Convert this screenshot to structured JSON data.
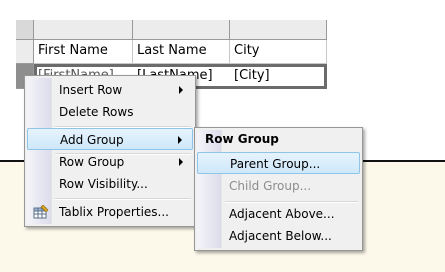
{
  "tablix": {
    "headers": [
      "First Name",
      "Last Name",
      "City"
    ],
    "placeholders": [
      "[FirstName]",
      "[LastName]",
      "[City]"
    ]
  },
  "context_menu": {
    "items": [
      {
        "label": "Insert Row",
        "submenu": true
      },
      {
        "label": "Delete Rows",
        "submenu": false
      },
      {
        "label": "Add Group",
        "submenu": true,
        "highlighted": true
      },
      {
        "label": "Row Group",
        "submenu": true
      },
      {
        "label": "Row Visibility...",
        "submenu": false
      },
      {
        "label": "Tablix Properties...",
        "submenu": false,
        "icon": "tablix-properties-icon"
      }
    ]
  },
  "submenu": {
    "header": "Row Group",
    "items": [
      {
        "label": "Parent Group...",
        "highlighted": true,
        "enabled": true
      },
      {
        "label": "Child Group...",
        "enabled": false
      },
      {
        "label": "Adjacent Above...",
        "enabled": true
      },
      {
        "label": "Adjacent Below...",
        "enabled": true
      }
    ]
  },
  "colors": {
    "highlight_bg": "#cfe8fa",
    "highlight_border": "#8ec4e8",
    "canvas_bg": "#fdf9ea",
    "disabled_text": "#8d8d8d"
  }
}
